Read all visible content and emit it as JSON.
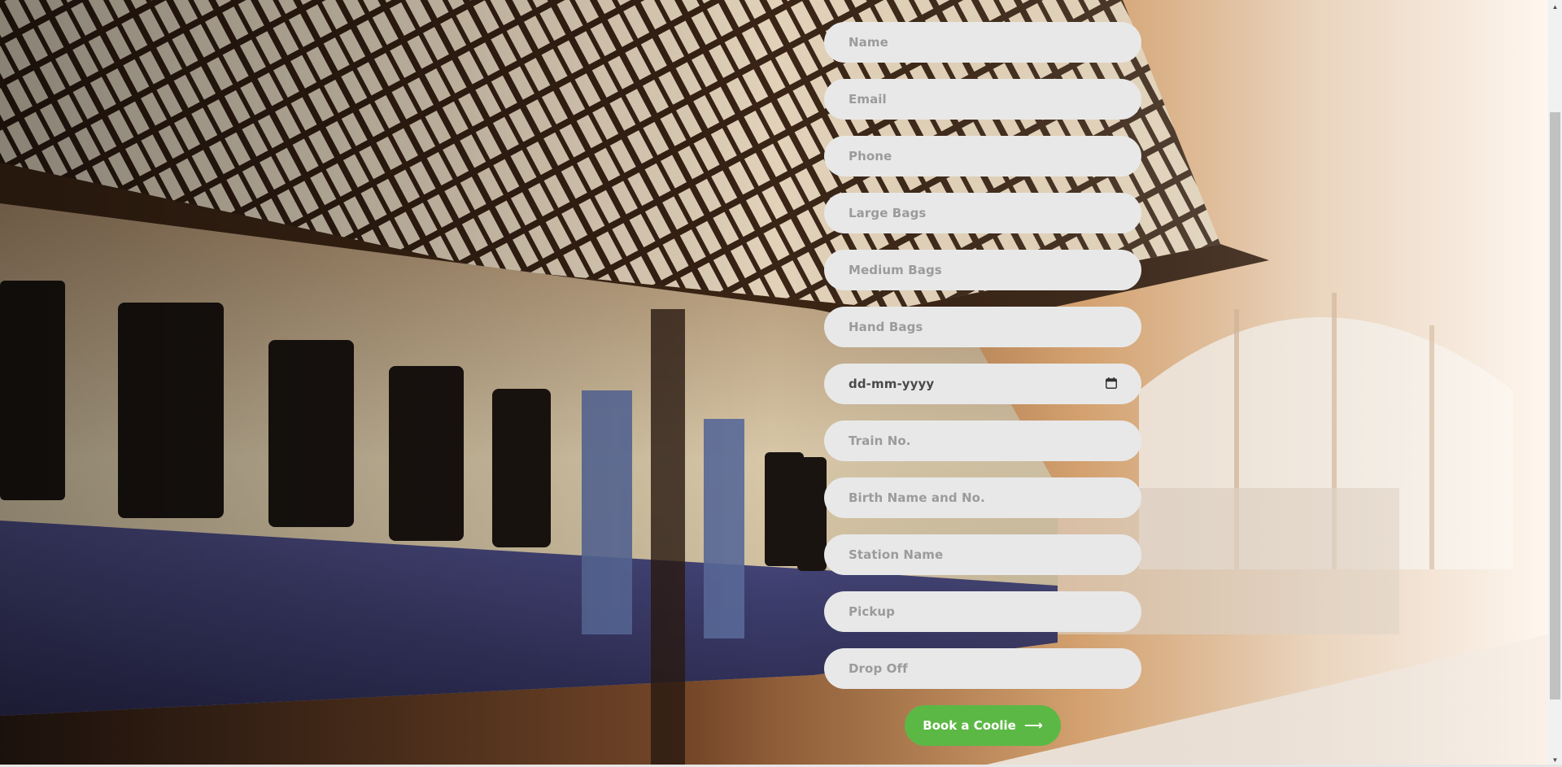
{
  "form": {
    "fields": [
      {
        "placeholder": "Name"
      },
      {
        "placeholder": "Email"
      },
      {
        "placeholder": "Phone"
      },
      {
        "placeholder": "Large Bags"
      },
      {
        "placeholder": "Medium Bags"
      },
      {
        "placeholder": "Hand Bags"
      },
      {
        "placeholder": "dd-mm-yyyy"
      },
      {
        "placeholder": "Train No."
      },
      {
        "placeholder": "Birth Name and No."
      },
      {
        "placeholder": "Station Name"
      },
      {
        "placeholder": "Pickup"
      },
      {
        "placeholder": "Drop Off"
      }
    ],
    "submit_label": "Book a Coolie",
    "submit_icon": "arrow-right-icon",
    "date_icon": "calendar-icon"
  },
  "colors": {
    "field_bg": "#e8e8e8",
    "placeholder": "#9b9b9b",
    "button": "#5cb845"
  },
  "background": {
    "image": "train-station-platform-photo"
  }
}
